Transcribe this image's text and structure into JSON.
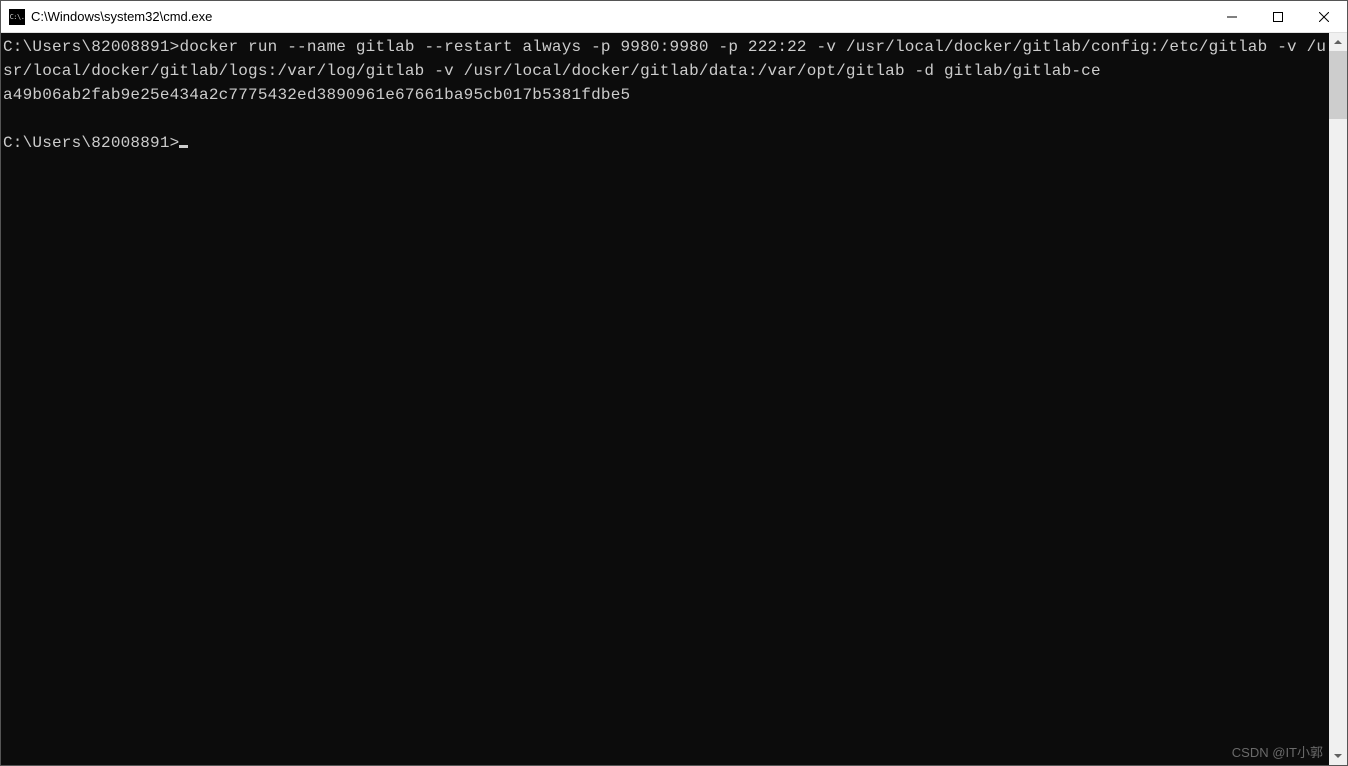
{
  "window": {
    "title": "C:\\Windows\\system32\\cmd.exe",
    "icon_text": "C:\\."
  },
  "terminal": {
    "prompt1": "C:\\Users\\82008891>",
    "command": "docker run --name gitlab --restart always -p 9980:9980 -p 222:22 -v /usr/local/docker/gitlab/config:/etc/gitlab -v /usr/local/docker/gitlab/logs:/var/log/gitlab -v /usr/local/docker/gitlab/data:/var/opt/gitlab -d gitlab/gitlab-ce",
    "output_line": "a49b06ab2fab9e25e434a2c7775432ed3890961e67661ba95cb017b5381fdbe5",
    "prompt2": "C:\\Users\\82008891>"
  },
  "watermark": "CSDN @IT小郭"
}
